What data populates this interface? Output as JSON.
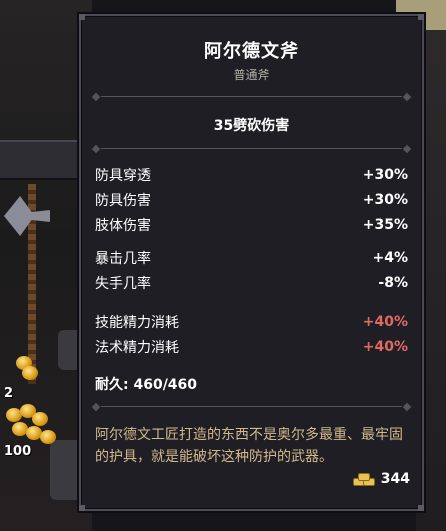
{
  "background": {
    "coin_stack_counts": [
      "2",
      "100"
    ]
  },
  "tooltip": {
    "name": "阿尔德文斧",
    "type": "普通斧",
    "damage": "35劈砍伤害",
    "stat_groups": [
      [
        {
          "label": "防具穿透",
          "value": "+30%",
          "tone": "positive"
        },
        {
          "label": "防具伤害",
          "value": "+30%",
          "tone": "positive"
        },
        {
          "label": "肢体伤害",
          "value": "+35%",
          "tone": "positive"
        }
      ],
      [
        {
          "label": "暴击几率",
          "value": "+4%",
          "tone": "positive"
        },
        {
          "label": "失手几率",
          "value": "-8%",
          "tone": "positive"
        }
      ],
      [
        {
          "label": "技能精力消耗",
          "value": "+40%",
          "tone": "negative"
        },
        {
          "label": "法术精力消耗",
          "value": "+40%",
          "tone": "negative"
        }
      ]
    ],
    "durability": "耐久: 460/460",
    "description": "阿尔德文工匠打造的东西不是奥尔多最重、最牢固的护具，就是能破坏这种防护的武器。",
    "price": "344",
    "colors": {
      "negative": "#e06a62",
      "description": "#d2b98d",
      "panel": "#1f1e24"
    }
  }
}
